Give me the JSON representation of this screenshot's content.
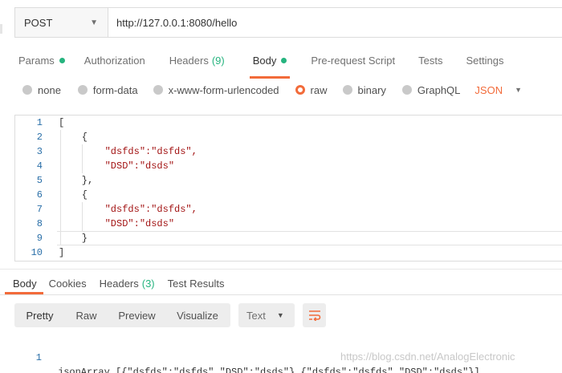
{
  "request": {
    "method": "POST",
    "url": "http://127.0.0.1:8080/hello"
  },
  "request_tabs": [
    {
      "label": "Params",
      "dot": true
    },
    {
      "label": "Authorization"
    },
    {
      "label": "Headers",
      "count": "(9)"
    },
    {
      "label": "Body",
      "dot": true,
      "active": true
    },
    {
      "label": "Pre-request Script"
    },
    {
      "label": "Tests"
    },
    {
      "label": "Settings"
    }
  ],
  "body_types": {
    "options": [
      "none",
      "form-data",
      "x-www-form-urlencoded",
      "raw",
      "binary",
      "GraphQL"
    ],
    "selected": "raw",
    "format": "JSON"
  },
  "editor_lines": [
    {
      "n": "1",
      "text": "["
    },
    {
      "n": "2",
      "text": "    {"
    },
    {
      "n": "3",
      "text": "        \"dsfds\":\"dsfds\","
    },
    {
      "n": "4",
      "text": "        \"DSD\":\"dsds\""
    },
    {
      "n": "5",
      "text": "    },"
    },
    {
      "n": "6",
      "text": "    {"
    },
    {
      "n": "7",
      "text": "        \"dsfds\":\"dsfds\","
    },
    {
      "n": "8",
      "text": "        \"DSD\":\"dsds\""
    },
    {
      "n": "9",
      "text": "    }"
    },
    {
      "n": "10",
      "text": "]"
    }
  ],
  "response_tabs": [
    {
      "label": "Body",
      "active": true
    },
    {
      "label": "Cookies"
    },
    {
      "label": "Headers",
      "count": "(3)"
    },
    {
      "label": "Test Results"
    }
  ],
  "view_modes": [
    "Pretty",
    "Raw",
    "Preview",
    "Visualize"
  ],
  "view_selected": "Pretty",
  "response_format": "Text",
  "response_lines": [
    {
      "n": "1",
      "text": "jsonArray [{\"dsfds\":\"dsfds\",\"DSD\":\"dsds\"},{\"dsfds\":\"dsfds\",\"DSD\":\"dsds\"}]"
    }
  ],
  "watermark": "https://blog.csdn.net/AnalogElectronic",
  "colors": {
    "accent": "#f26b3a",
    "ok": "#26b47f",
    "linenum": "#2a6fa8",
    "string": "#a31515"
  }
}
